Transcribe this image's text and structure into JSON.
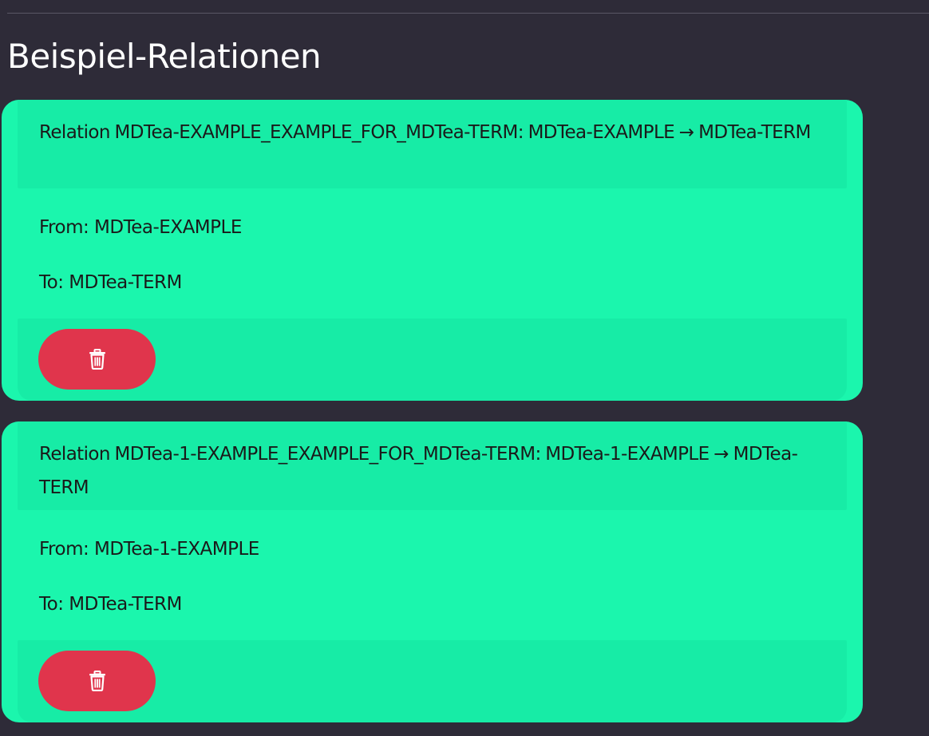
{
  "page": {
    "title": "Beispiel-Relationen"
  },
  "relations": [
    {
      "header": "Relation MDTea-EXAMPLE_EXAMPLE_FOR_MDTea-TERM: MDTea-EXAMPLE → MDTea-TERM",
      "from": "From: MDTea-EXAMPLE",
      "to": "To: MDTea-TERM",
      "delete_icon": "trash-icon"
    },
    {
      "header": "Relation MDTea-1-EXAMPLE_EXAMPLE_FOR_MDTea-TERM: MDTea-1-EXAMPLE → MDTea-TERM",
      "from": "From: MDTea-1-EXAMPLE",
      "to": "To: MDTea-TERM",
      "delete_icon": "trash-icon"
    }
  ],
  "colors": {
    "background": "#2e2b38",
    "card": "#1bf6ad",
    "card_header": "#17eca6",
    "delete_button": "#e0354c"
  }
}
